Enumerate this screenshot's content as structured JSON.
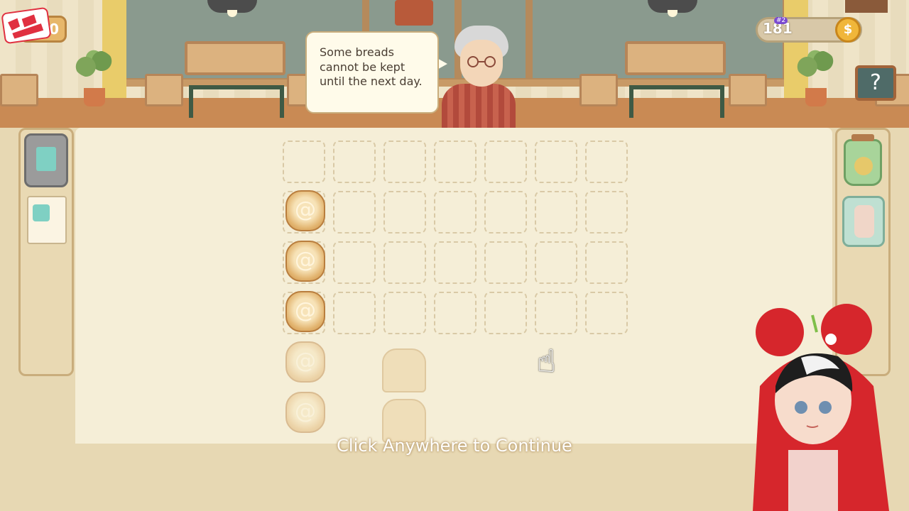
{
  "hud": {
    "logo_text": "",
    "money_value": "00",
    "coin_count": "181",
    "rank_badge": "#2",
    "coin_symbol": "$",
    "help_label": "?"
  },
  "dialogue": {
    "speaker": "grandpa",
    "text": "Some breads cannot be kept until the next day."
  },
  "prompt": {
    "continue_label": "Click Anywhere to Continue"
  },
  "board": {
    "grid_columns": 7,
    "grid_rows": 4,
    "breads": [
      {
        "type": "cinnamon-roll",
        "column": 1,
        "row": 2,
        "faded": false
      },
      {
        "type": "cinnamon-roll",
        "column": 1,
        "row": 3,
        "faded": false
      },
      {
        "type": "cinnamon-roll",
        "column": 1,
        "row": 4,
        "faded": false
      },
      {
        "type": "cinnamon-roll",
        "column": 1,
        "row": 5,
        "faded": true
      },
      {
        "type": "cinnamon-roll",
        "column": 1,
        "row": 6,
        "faded": true
      },
      {
        "type": "toast",
        "column": 3,
        "row": 5,
        "faded": true
      },
      {
        "type": "toast",
        "column": 3,
        "row": 6,
        "faded": true
      }
    ]
  },
  "colors": {
    "board_bg": "#f6eed8",
    "wood": "#c98a54",
    "accent_green": "#3f5a45",
    "bread": "#e2b46f"
  },
  "icons": {
    "left_panel": [
      "fridge-icon",
      "recipe-card-icon"
    ],
    "right_panel": [
      "coin-jar-icon",
      "bread-bag-icon"
    ]
  }
}
